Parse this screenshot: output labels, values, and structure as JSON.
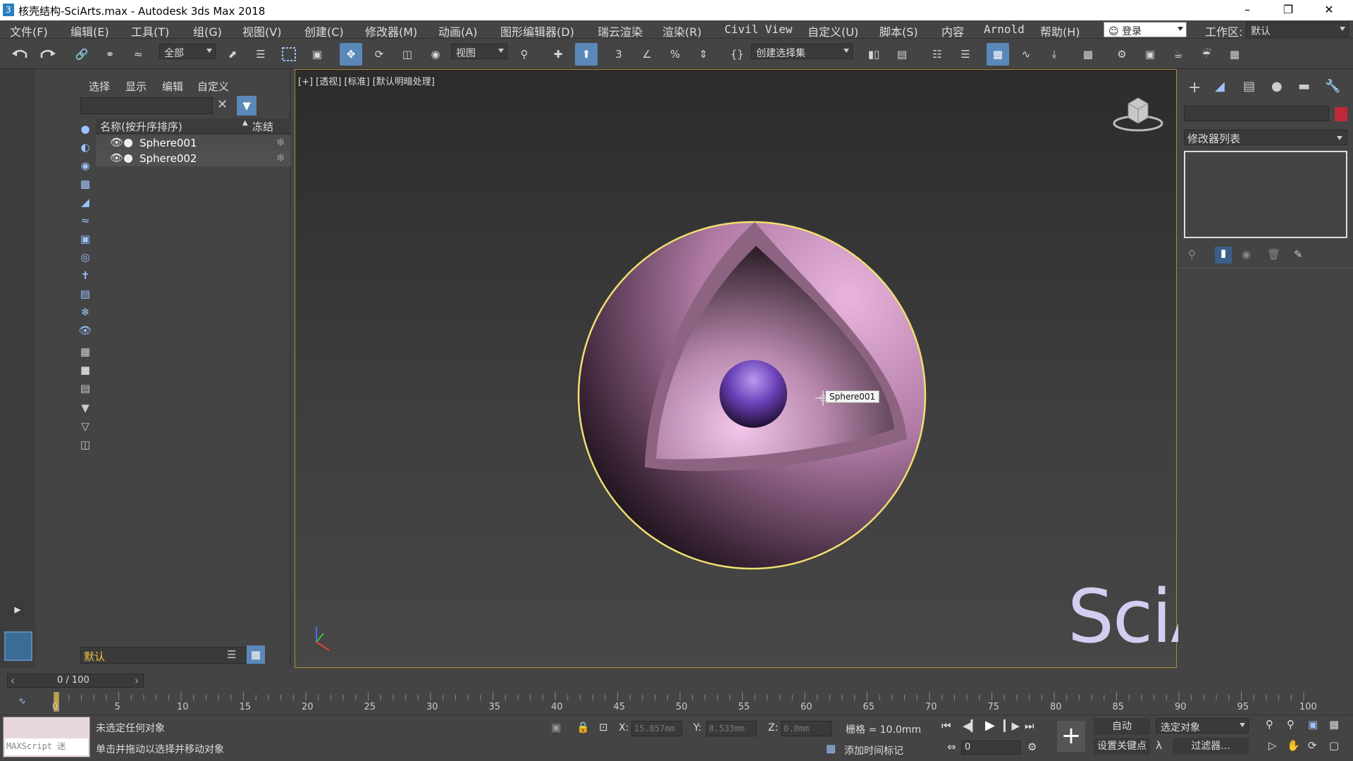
{
  "window": {
    "title": "核壳结构-SciArts.max - Autodesk 3ds Max 2018",
    "app_icon": "3"
  },
  "menu": {
    "items": [
      "文件(F)",
      "编辑(E)",
      "工具(T)",
      "组(G)",
      "视图(V)",
      "创建(C)",
      "修改器(M)",
      "动画(A)",
      "图形编辑器(D)",
      "瑞云渲染",
      "渲染(R)",
      "Civil View",
      "自定义(U)",
      "脚本(S)",
      "内容",
      "Arnold",
      "帮助(H)"
    ],
    "login": "登录",
    "workspace_label": "工作区:",
    "workspace_value": "默认"
  },
  "toolbar": {
    "selection_filter": "全部",
    "ref_coord": "视图",
    "named_selection": "创建选择集"
  },
  "explorer": {
    "tabs": [
      "选择",
      "显示",
      "编辑",
      "自定义"
    ],
    "col_name": "名称(按升序排序)",
    "col_freeze": "冻结",
    "objects": [
      "Sphere001",
      "Sphere002"
    ],
    "layer": "默认"
  },
  "viewport": {
    "label": "[+] [透视] [标准] [默认明暗处理]",
    "tooltip": "Sphere001",
    "watermark": "SciArts"
  },
  "rightpanel": {
    "modifier_list": "修改器列表"
  },
  "timeline": {
    "frame_display": "0 / 100",
    "ticks": [
      "0",
      "5",
      "10",
      "15",
      "20",
      "25",
      "30",
      "35",
      "40",
      "45",
      "50",
      "55",
      "60",
      "65",
      "70",
      "75",
      "80",
      "85",
      "90",
      "95",
      "100"
    ]
  },
  "status": {
    "maxscript": "MAXScript 迷",
    "line1": "未选定任何对象",
    "line2": "单击并拖动以选择并移动对象",
    "x_label": "X:",
    "x_value": "15.857mm",
    "y_label": "Y:",
    "y_value": "8.533mm",
    "z_label": "Z:",
    "z_value": "0.0mm",
    "grid": "栅格 = 10.0mm",
    "add_time_tag": "添加时间标记",
    "auto": "自动",
    "set_key": "设置关键点",
    "selected_object": "选定对象",
    "filters": "过滤器...",
    "frame_value": "0"
  }
}
